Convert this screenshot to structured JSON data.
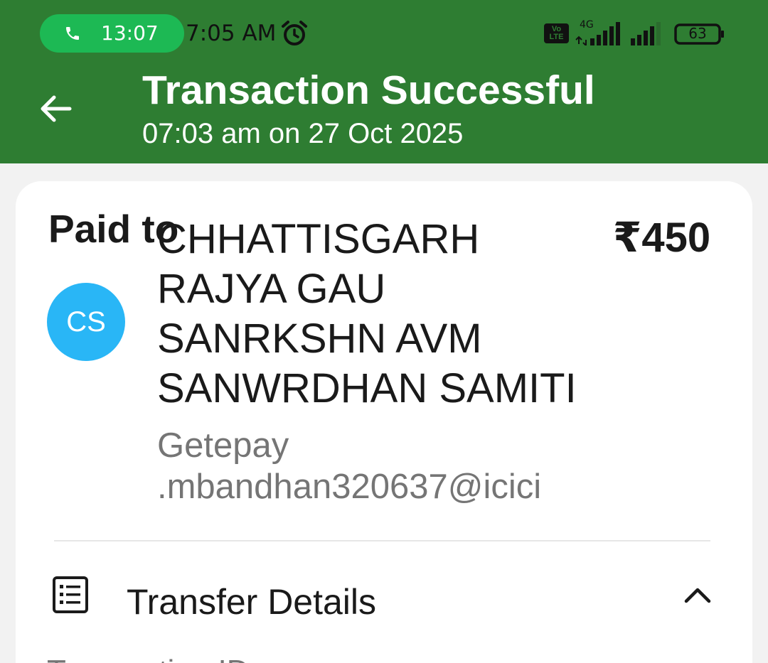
{
  "status_bar": {
    "call_time": "13:07",
    "clock": "7:05 AM",
    "volte": "Vo LTE",
    "network": "4G",
    "battery": "63",
    "icons": [
      "phone-icon",
      "alarm-icon",
      "volte-icon",
      "signal-icon",
      "battery-icon"
    ]
  },
  "header": {
    "title": "Transaction Successful",
    "subtitle": "07:03 am on 27 Oct 2025",
    "back_icon": "arrow-left-icon",
    "color": "#2e7d32"
  },
  "payment": {
    "paid_to_label": "Paid to",
    "amount": "₹450",
    "avatar_initials": "CS",
    "avatar_color": "#29b6f6",
    "payee_name_lines": [
      "CHHATTISGARH",
      "RAJYA GAU",
      "SANRKSHN AVM",
      "SANWRDHAN SAMITI"
    ],
    "payee_vpa_lines": [
      "Getepay",
      ".mbandhan320637@icici"
    ]
  },
  "transfer_details": {
    "label": "Transfer Details",
    "icon": "receipt-list-icon",
    "toggle_icon": "chevron-up-icon",
    "next_row_label": "Transaction ID"
  }
}
